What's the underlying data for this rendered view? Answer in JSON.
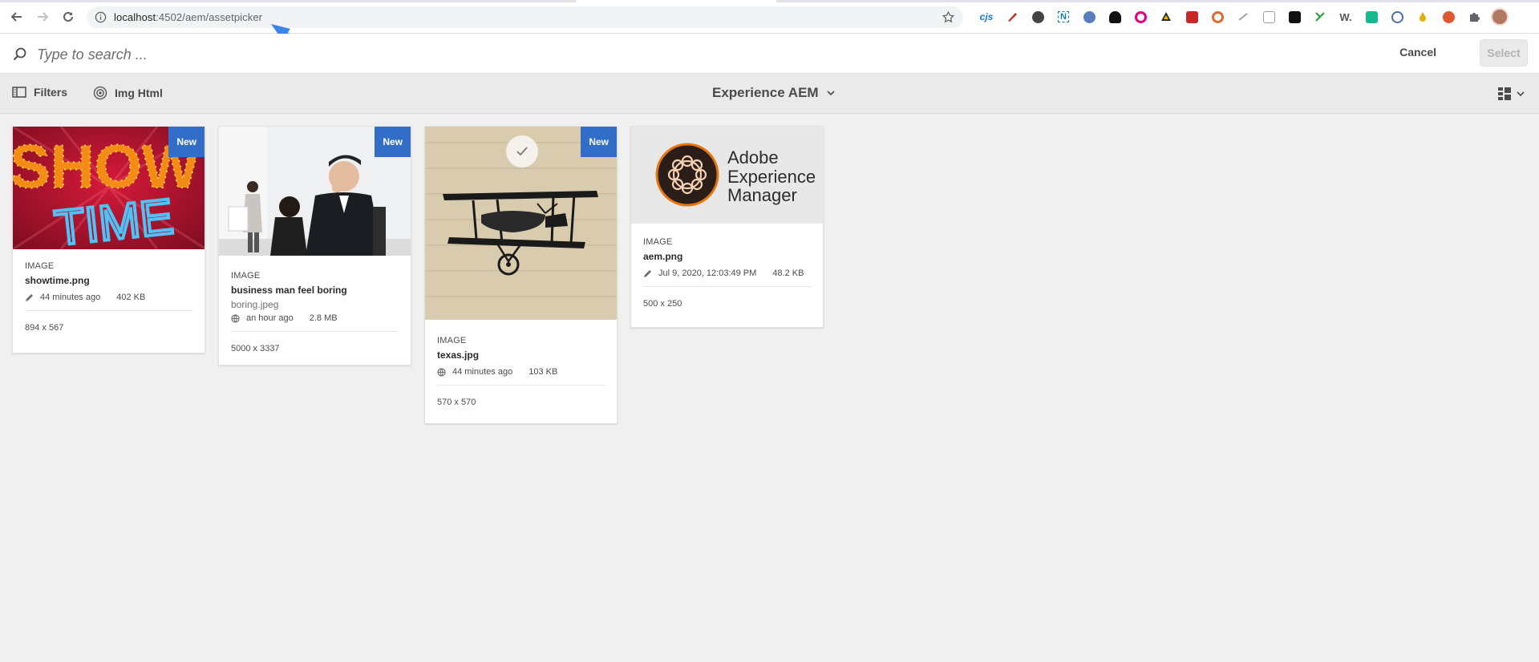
{
  "browser": {
    "url_host": "localhost",
    "url_path": ":4502/aem/assetpicker",
    "extensions": [
      "cjs-ext-icon",
      "pen-ext-icon",
      "circle-ext-icon",
      "n-ext-icon",
      "feather-ext-icon",
      "spy-ext-icon",
      "eye-ext-icon",
      "triangle-ext-icon",
      "red-square-ext-icon",
      "ring-ext-icon",
      "slash-ext-icon",
      "box-ext-icon",
      "toolbox-ext-icon",
      "k-ext-icon",
      "w-ext-icon",
      "c-ext-icon",
      "g-ext-icon",
      "drop-ext-icon",
      "duck-ext-icon",
      "puzzle-icon"
    ],
    "ext_text": {
      "cjs": "cjs",
      "w": "W.",
      "n": "N"
    }
  },
  "search": {
    "placeholder": "Type to search ...",
    "cancel_label": "Cancel",
    "select_label": "Select"
  },
  "actionbar": {
    "filters_label": "Filters",
    "imghtml_label": "Img Html",
    "title": "Experience AEM"
  },
  "assets": [
    {
      "badge": "New",
      "type": "IMAGE",
      "title": "showtime.png",
      "modified": "44 minutes ago",
      "size": "402 KB",
      "dimensions": "894 x 567",
      "thumb_text": [
        "SHOW",
        "TIME"
      ]
    },
    {
      "badge": "New",
      "type": "IMAGE",
      "title": "business man feel boring",
      "subtitle": "boring.jpeg",
      "modified": "an hour ago",
      "size": "2.8 MB",
      "dimensions": "5000 x 3337"
    },
    {
      "badge": "New",
      "type": "IMAGE",
      "title": "texas.jpg",
      "modified": "44 minutes ago",
      "size": "103 KB",
      "dimensions": "570 x 570",
      "selected": true
    },
    {
      "type": "IMAGE",
      "title": "aem.png",
      "modified": "Jul 9, 2020, 12:03:49 PM",
      "size": "48.2 KB",
      "dimensions": "500 x 250",
      "thumb_text": [
        "Adobe",
        "Experience",
        "Manager"
      ]
    }
  ],
  "colors": {
    "badge": "#326ec8",
    "annotation_arrow": "#3a86e8"
  }
}
